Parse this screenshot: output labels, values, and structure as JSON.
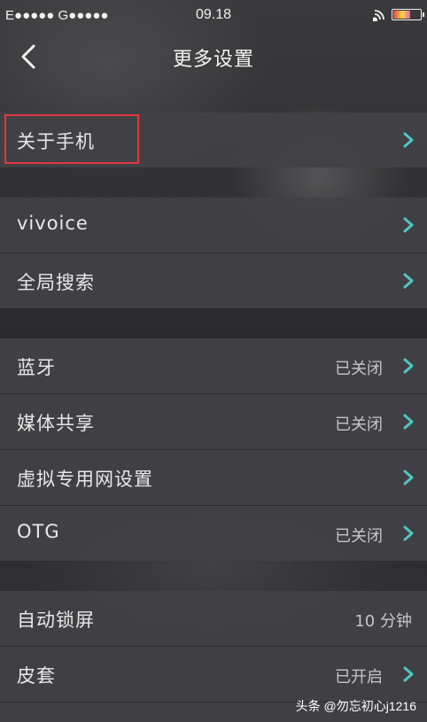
{
  "status_bar": {
    "carrier": "E●●●●● G●●●●●",
    "time": "09.18"
  },
  "header": {
    "title": "更多设置",
    "back_icon": "chevron-left-icon"
  },
  "rows": [
    {
      "label": "关于手机",
      "value": "",
      "arrow": true
    },
    {
      "label": "vivoice",
      "value": "",
      "arrow": true
    },
    {
      "label": "全局搜索",
      "value": "",
      "arrow": true
    },
    {
      "label": "蓝牙",
      "value": "已关闭",
      "arrow": true
    },
    {
      "label": "媒体共享",
      "value": "已关闭",
      "arrow": true
    },
    {
      "label": "虚拟专用网设置",
      "value": "",
      "arrow": true
    },
    {
      "label": "OTG",
      "value": "已关闭",
      "arrow": true
    },
    {
      "label": "自动锁屏",
      "value": "10 分钟",
      "arrow": false
    },
    {
      "label": "皮套",
      "value": "已开启",
      "arrow": true
    }
  ],
  "colors": {
    "accent_arrow": "#4fc7c2",
    "highlight": "#e0383c"
  },
  "watermark": "头条 @勿忘初心j1216"
}
